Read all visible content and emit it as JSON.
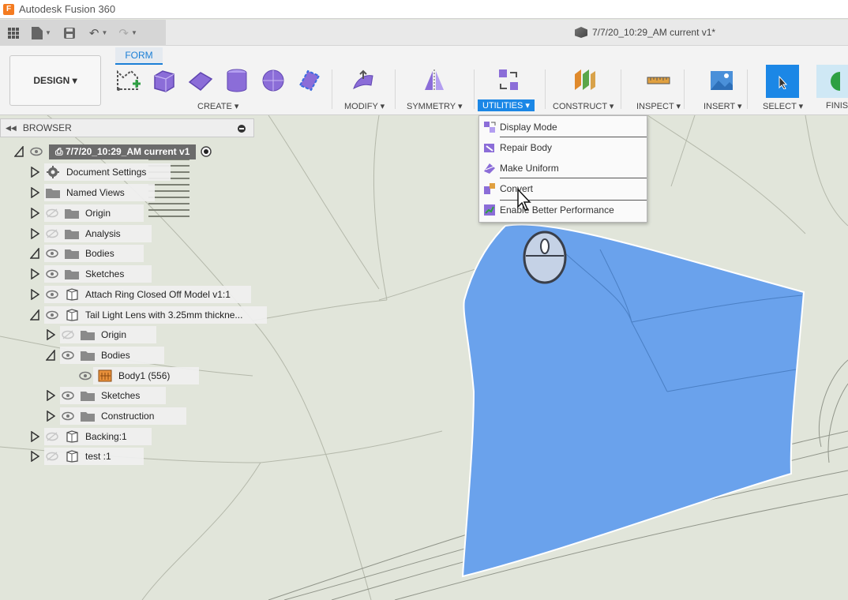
{
  "window": {
    "app_title": "Autodesk Fusion 360",
    "app_icon_letter": "F"
  },
  "quick_access": {
    "document_title": "7/7/20_10:29_AM current v1*"
  },
  "ribbon": {
    "workspace_button": "DESIGN ▾",
    "active_tab": "FORM",
    "groups": {
      "create": "CREATE ▾",
      "modify": "MODIFY ▾",
      "symmetry": "SYMMETRY ▾",
      "utilities": "UTILITIES ▾",
      "construct": "CONSTRUCT ▾",
      "inspect": "INSPECT ▾",
      "insert": "INSERT ▾",
      "select": "SELECT ▾",
      "finish": "FINIS"
    }
  },
  "browser": {
    "title": "BROWSER",
    "root": "7/7/20_10:29_AM current v1",
    "items": [
      {
        "label": "Document Settings"
      },
      {
        "label": "Named Views"
      },
      {
        "label": "Origin"
      },
      {
        "label": "Analysis"
      },
      {
        "label": "Bodies"
      },
      {
        "label": "Sketches"
      },
      {
        "label": "Attach Ring Closed Off Model v1:1"
      },
      {
        "label": "Tail Light Lens with 3.25mm thickne..."
      },
      {
        "label": "Origin"
      },
      {
        "label": "Bodies"
      },
      {
        "label": "Body1 (556)"
      },
      {
        "label": "Sketches"
      },
      {
        "label": "Construction"
      },
      {
        "label": "Backing:1"
      },
      {
        "label": "test :1"
      }
    ]
  },
  "utilities_menu": {
    "items": [
      {
        "label": "Display Mode",
        "icon": "display-mode-icon"
      },
      {
        "label": "Repair Body",
        "icon": "repair-body-icon"
      },
      {
        "label": "Make Uniform",
        "icon": "make-uniform-icon"
      },
      {
        "label": "Convert",
        "icon": "convert-icon"
      },
      {
        "label": "Enable Better Performance",
        "icon": "performance-icon"
      }
    ]
  },
  "colors": {
    "accent": "#1b87e6",
    "surface_body": "#6aa2ec",
    "viewport_bg": "#e3e6dc"
  }
}
